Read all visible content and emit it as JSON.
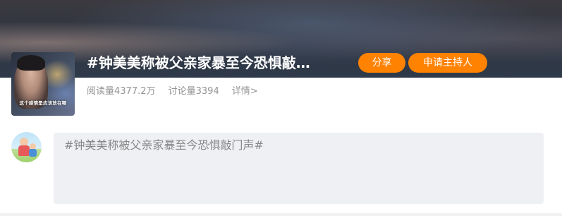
{
  "topic": {
    "title": "#钟美美称被父亲家暴至今恐惧敲…",
    "cover_caption": "这个感情是应该放在哪"
  },
  "actions": {
    "share_label": "分享",
    "apply_host_label": "申请主持人"
  },
  "stats": {
    "reads": "阅读量4377.2万",
    "discussions": "讨论量3394",
    "details": "详情>"
  },
  "composer": {
    "value": "#钟美美称被父亲家暴至今恐惧敲门声#"
  },
  "colors": {
    "accent": "#ff8200",
    "stats_text": "#939393",
    "composer_bg": "#eff0f4"
  }
}
